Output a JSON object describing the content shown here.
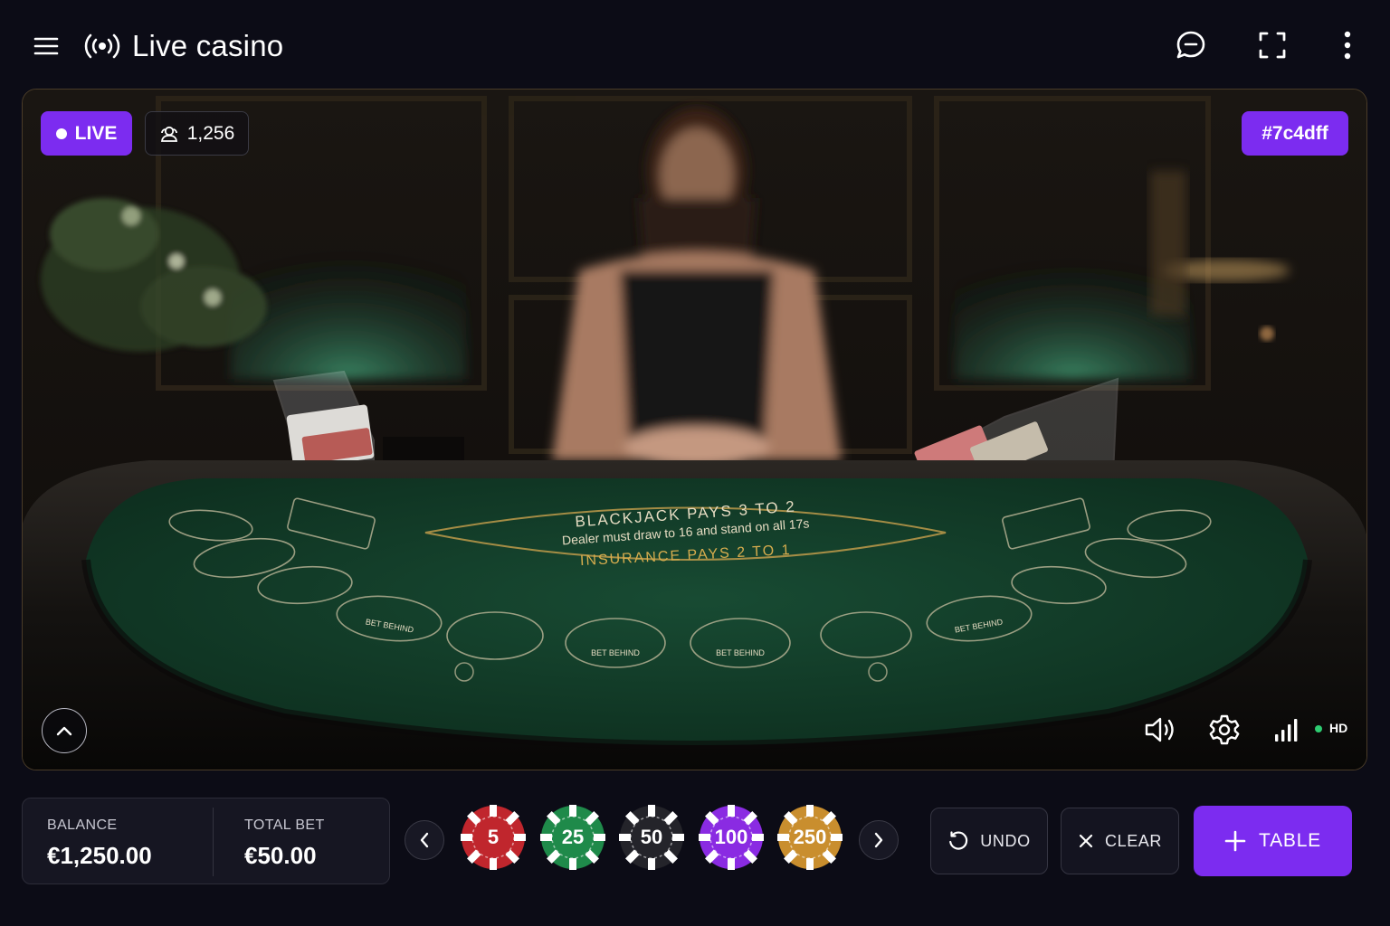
{
  "header": {
    "title": "Live casino",
    "menu_icon": "hamburger-menu-icon",
    "live_icon": "broadcast-icon",
    "chat_icon": "chat-bubble-icon",
    "fullscreen_icon": "fullscreen-icon",
    "more_icon": "more-vertical-icon"
  },
  "stage": {
    "live_label": "LIVE",
    "viewers": "1,256",
    "table_id": "#7c4dff",
    "felt_text": {
      "line1": "BLACKJACK PAYS 3 TO 2",
      "line2": "Dealer must draw to 16 and stand on all 17s",
      "line3": "INSURANCE PAYS 2 TO 1",
      "bet_behind": "BET BEHIND"
    },
    "quality": "HD",
    "accent_color": "#7c2cf0",
    "felt_color": "#123d2a"
  },
  "balance": {
    "balance_label": "BALANCE",
    "balance_value": "€1,250.00",
    "bet_label": "TOTAL BET",
    "bet_value": "€50.00"
  },
  "chips": [
    {
      "value": "5",
      "color": "#c0262d"
    },
    {
      "value": "25",
      "color": "#1f8a4a"
    },
    {
      "value": "50",
      "color": "#24242a"
    },
    {
      "value": "100",
      "color": "#8a2be2"
    },
    {
      "value": "250",
      "color": "#c98e2e"
    }
  ],
  "actions": {
    "undo": "UNDO",
    "clear": "CLEAR",
    "table": "TABLE"
  }
}
